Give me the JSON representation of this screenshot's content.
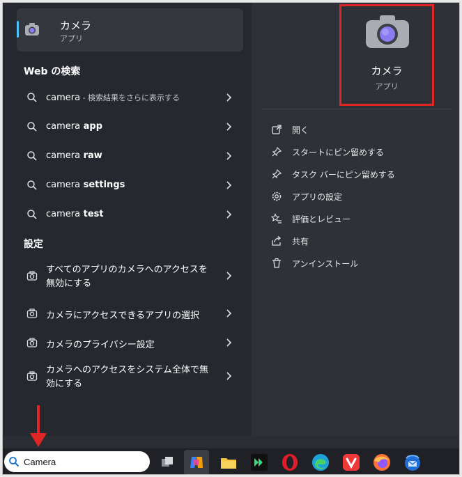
{
  "best_match": {
    "title": "カメラ",
    "subtitle": "アプリ"
  },
  "web_search": {
    "header": "Web の検索",
    "items": [
      {
        "query": "camera",
        "hint": " - 検索結果をさらに表示する"
      },
      {
        "query": "camera",
        "bold": " app"
      },
      {
        "query": "camera",
        "bold": " raw"
      },
      {
        "query": "camera",
        "bold": " settings"
      },
      {
        "query": "camera",
        "bold": " test"
      }
    ]
  },
  "settings": {
    "header": "設定",
    "items": [
      "すべてのアプリのカメラへのアクセスを無効にする",
      "カメラにアクセスできるアプリの選択",
      "カメラのプライバシー設定",
      "カメラへのアクセスをシステム全体で無効にする"
    ]
  },
  "app_card": {
    "title": "カメラ",
    "subtitle": "アプリ"
  },
  "actions": [
    "開く",
    "スタートにピン留めする",
    "タスク バーにピン留めする",
    "アプリの設定",
    "評価とレビュー",
    "共有",
    "アンインストール"
  ],
  "taskbar": {
    "search_value": "Camera"
  },
  "colors": {
    "highlight": "#e02525",
    "accent": "#4cc2ff"
  }
}
